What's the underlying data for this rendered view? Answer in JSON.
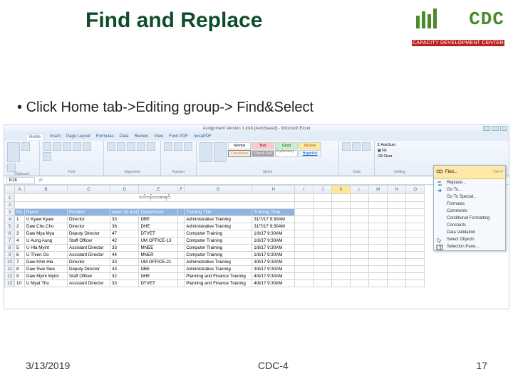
{
  "slide": {
    "title": "Find and Replace",
    "bullet": "Click Home tab->Editing group-> Find&Select",
    "date": "3/13/2019",
    "footer_center": "CDC-4",
    "page_number": "17"
  },
  "logo": {
    "text": "CDC",
    "subtitle": "CAPACITY DEVELOPMENT CENTER"
  },
  "excel": {
    "window_title": "Assignment Version 1.xlsb [AutoSaved] - Microsoft Excel",
    "tabs": [
      "Home",
      "Insert",
      "Page Layout",
      "Formulas",
      "Data",
      "Review",
      "View",
      "Foxit PDF",
      "novaPDF"
    ],
    "ribbon_groups": {
      "clipboard": "Clipboard",
      "font": "Font",
      "alignment": "Alignment",
      "number": "Number",
      "styles": "Styles",
      "cells": "Cells",
      "editing": "Editing"
    },
    "style_cells": {
      "normal": "Normal",
      "bad": "Bad",
      "good": "Good",
      "neutral": "Neutral",
      "calculation": "Calculation",
      "checkcell": "Check Cell",
      "explanatory": "Explanatory ...",
      "hyperlink": "Hyperlink"
    },
    "editing_items": {
      "autosum": "AutoSum",
      "fill": "Fill",
      "clear": "Clear"
    },
    "namebox": "K18",
    "columns": [
      "",
      "A",
      "B",
      "C",
      "D",
      "E",
      "F",
      "G",
      "H",
      "I",
      "J",
      "K",
      "L",
      "M",
      "N",
      "O"
    ],
    "title_row": "သင်တန်းသားစာရင်း",
    "headers": [
      "No",
      "Name",
      "Position",
      "ween 30 and",
      "Department",
      "",
      "Training Title",
      "Training Time"
    ],
    "rows": [
      [
        "1",
        "U Kyaw Kyaw",
        "Director",
        "33",
        "DBE",
        "",
        "Administrative Training",
        "31/7/17 9:30AM"
      ],
      [
        "2",
        "Daw Cho Cho",
        "Director",
        "36",
        "DHE",
        "",
        "Administrative Training",
        "31/7/17 9:30AM"
      ],
      [
        "3",
        "Daw Mya Mya",
        "Deputy Director",
        "47",
        "DTVET",
        "",
        "Computer Training",
        "1/8/17 9:30AM"
      ],
      [
        "4",
        "U Aung Aung",
        "Staff Officer",
        "42",
        "UM OFFICE-13",
        "",
        "Computer Training",
        "1/8/17 9:30AM"
      ],
      [
        "5",
        "U Hla Myint",
        "Assistant Director",
        "33",
        "MNEE",
        "",
        "Computer Training",
        "1/8/17 9:30AM"
      ],
      [
        "6",
        "U Thien Oo",
        "Assistant Director",
        "44",
        "MNER",
        "",
        "Computer Training",
        "1/8/17 9:30AM"
      ],
      [
        "7",
        "Daw Khin Hla",
        "Director",
        "33",
        "UM OFFICE-21",
        "",
        "Administrative Training",
        "3/8/17 9:30AM"
      ],
      [
        "8",
        "Daw Swe Swe",
        "Deputy Director",
        "43",
        "DBE",
        "",
        "Administrative Training",
        "3/8/17 9:30AM"
      ],
      [
        "9",
        "Daw Myint Myint",
        "Staff Officer",
        "32",
        "DHE",
        "",
        "Planning and Finance Training",
        "4/8/17 9:30AM"
      ],
      [
        "10",
        "U Myat Thu",
        "Assistant Director",
        "33",
        "DTVET",
        "",
        "Planning and Finance Training",
        "4/8/17 9:30AM"
      ]
    ]
  },
  "find_menu": {
    "find": "Find...",
    "find_shortcut": "Ctrl+F",
    "replace": "Replace...",
    "goto": "Go To...",
    "goto_special": "Go To Special...",
    "formulas": "Formulas",
    "comments": "Comments",
    "cond_fmt": "Conditional Formatting",
    "constants": "Constants",
    "data_validation": "Data Validation",
    "select_objects": "Select Objects",
    "selection_pane": "Selection Pane..."
  }
}
